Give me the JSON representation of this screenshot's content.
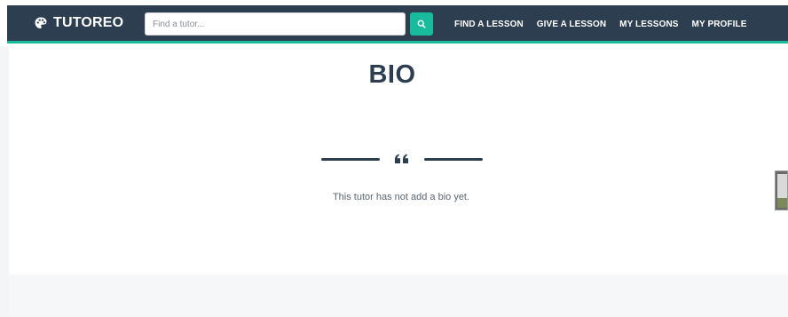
{
  "navbar": {
    "brand": "TUTOREO",
    "search": {
      "placeholder": "Find a tutor..."
    },
    "links": [
      "FIND A LESSON",
      "GIVE A LESSON",
      "MY LESSONS",
      "MY PROFILE"
    ]
  },
  "bio": {
    "title": "BIO",
    "message": "This tutor has not add a bio yet."
  },
  "colors": {
    "navbar_bg": "#2c3e50",
    "accent": "#18bc9c",
    "heading": "#2c3e50",
    "body_text": "#5a6672"
  },
  "icons": {
    "brand": "palette-icon",
    "search": "search-icon",
    "divider": "quote-icon"
  }
}
